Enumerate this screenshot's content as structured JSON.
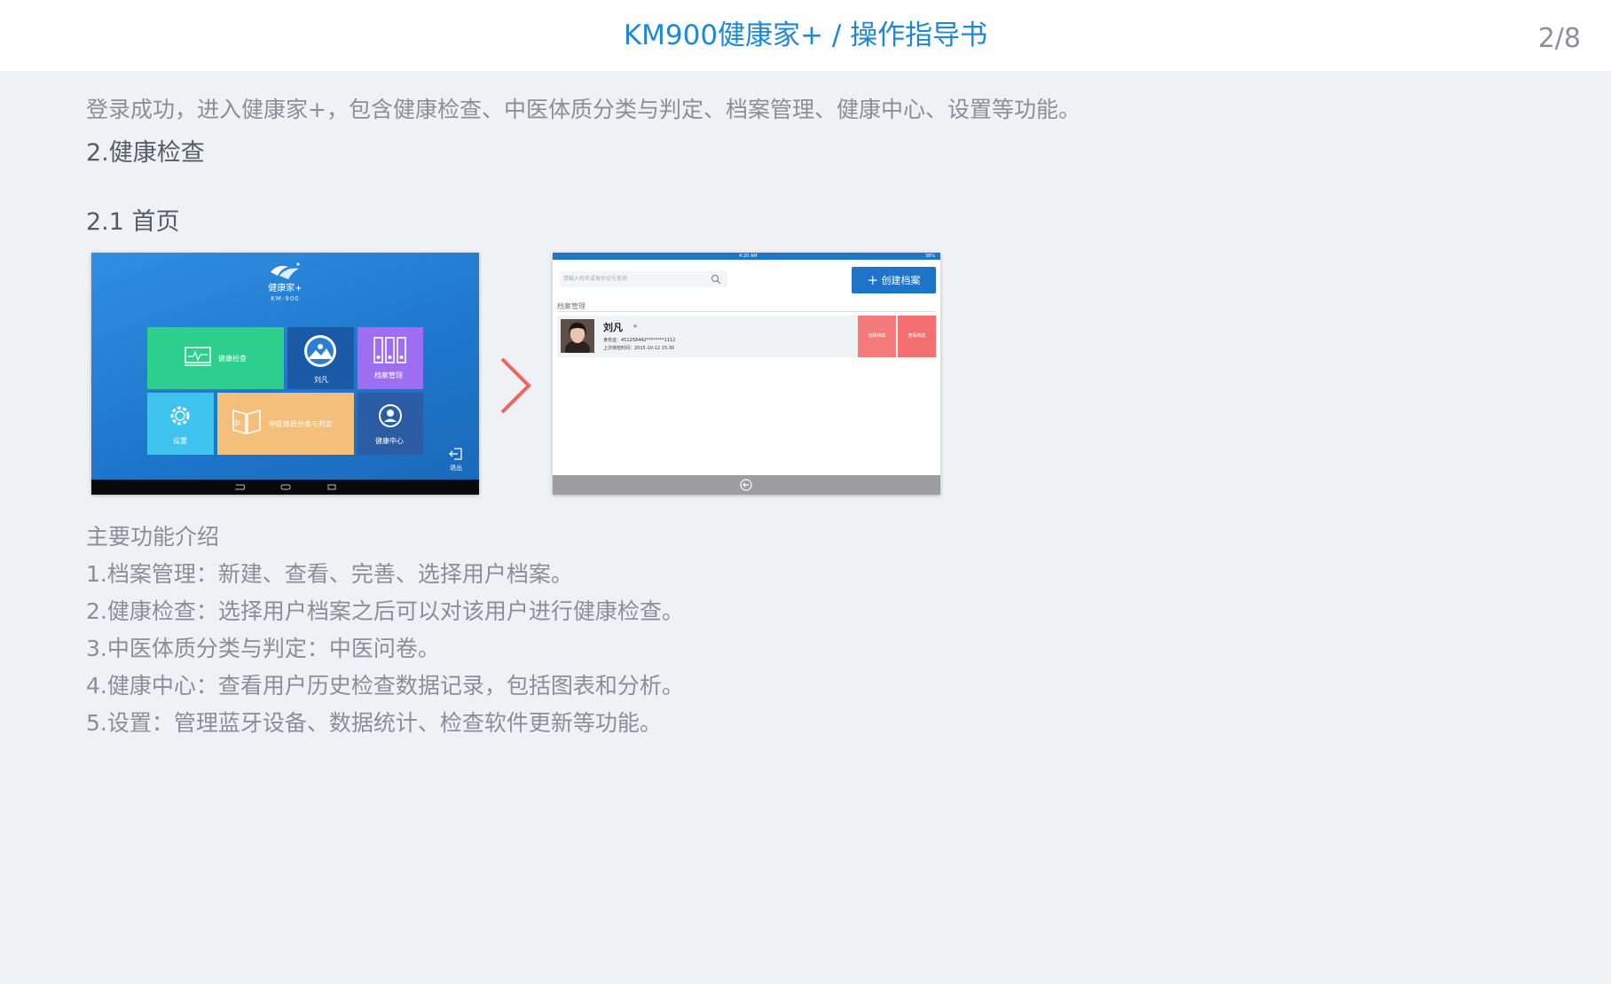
{
  "header": {
    "title": "KM900健康家+ / 操作指导书",
    "page": "2/8"
  },
  "intro": "登录成功，进入健康家+，包含健康检查、中医体质分类与判定、档案管理、健康中心、设置等功能。",
  "section_heading": "2.健康检查",
  "subsection_heading": "2.1 首页",
  "home_screen": {
    "app_name": "健康家+",
    "app_model": "KM-900",
    "tiles": {
      "check": "健康检查",
      "user": "刘凡",
      "archive": "档案管理",
      "settings": "设置",
      "tcm": "中医体质分类与判定",
      "health_center": "健康中心"
    },
    "exit_label": "退出"
  },
  "archive_screen": {
    "status_time": "4:20 AM",
    "status_battery": "38%",
    "search_placeholder": "请输入姓名或身份证号查询",
    "create_button": "创建档案",
    "section_label": "档案管理",
    "record": {
      "name": "刘凡",
      "star": "★",
      "id_line": "身份证：451258442********1112",
      "time_line": "上次体检时间：2015-10-12 15:30",
      "select_button": "选择档案",
      "view_button": "查看档案"
    }
  },
  "functions": {
    "title": "主要功能介绍",
    "items": [
      "1.档案管理：新建、查看、完善、选择用户档案。",
      "2.健康检查：选择用户档案之后可以对该用户进行健康检查。",
      "3.中医体质分类与判定：中医问卷。",
      "4.健康中心：查看用户历史检查数据记录，包括图表和分析。",
      "5.设置：管理蓝牙设备、数据统计、检查软件更新等功能。"
    ]
  }
}
